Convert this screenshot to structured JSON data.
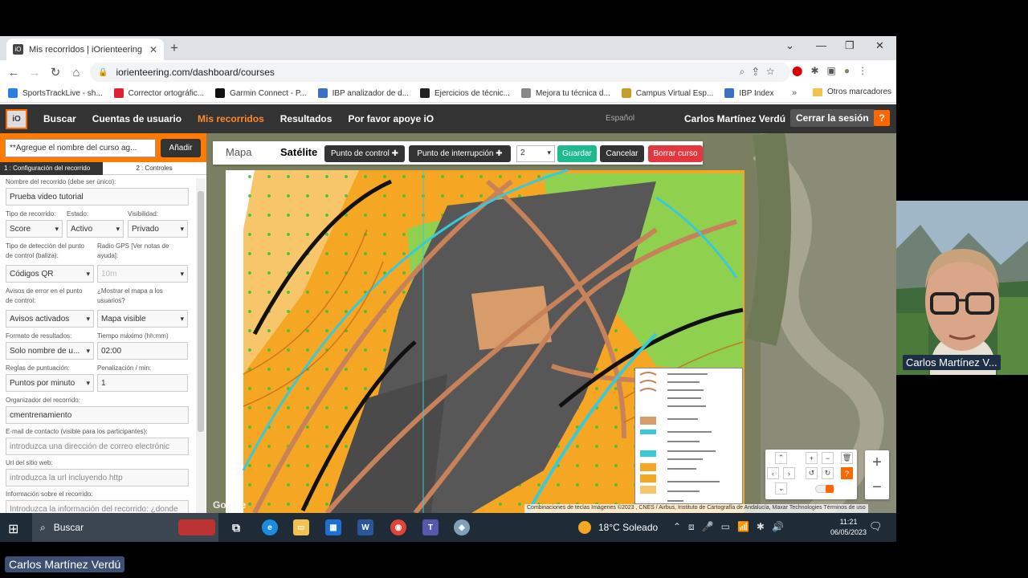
{
  "browser": {
    "tab_title": "Mis recorridos | iOrienteering",
    "tab_favicon": "iO",
    "url": "iorienteering.com/dashboard/courses",
    "bookmarks": [
      {
        "label": "SportsTrackLive - sh...",
        "color": "#2a7de1"
      },
      {
        "label": "Corrector ortográfic...",
        "color": "#d23"
      },
      {
        "label": "Garmin Connect - P...",
        "color": "#111"
      },
      {
        "label": "IBP analizador de d...",
        "color": "#3b6fc4"
      },
      {
        "label": "Ejercicios de técnic...",
        "color": "#222"
      },
      {
        "label": "Mejora tu técnica d...",
        "color": "#888"
      },
      {
        "label": "Campus Virtual Esp...",
        "color": "#c89b2a"
      },
      {
        "label": "IBP Index",
        "color": "#3b6fc4"
      }
    ],
    "bookmarks_more": "»",
    "other_bookmarks": "Otros marcadores"
  },
  "app": {
    "logo": "iO",
    "nav": [
      "Buscar",
      "Cuentas de usuario",
      "Mis recorridos",
      "Resultados",
      "Por favor apoye iO"
    ],
    "active_nav": "Mis recorridos",
    "language": "Español",
    "user_name": "Carlos Martínez Verdú",
    "logout": "Cerrar la sesión",
    "help": "?",
    "accent_color": "#ff7a00"
  },
  "left": {
    "course_select": "**Agregue el nombre del curso ag...",
    "add_button": "Añadir",
    "tab1": "1 : Configuración del recorrido",
    "tab2": "2 : Controles",
    "fields": {
      "name_label": "Nombre del recorrido (debe ser único):",
      "name_value": "Prueba video tutorial",
      "type_label": "Tipo de recorrido:",
      "type_value": "Score",
      "status_label": "Estado:",
      "status_value": "Activo",
      "visibility_label": "Visibilidad:",
      "visibility_value": "Privado",
      "detection_label_1": "Tipo de detección del punto",
      "detection_label_2": "de control (baliza):",
      "detection_value": "Códigos QR",
      "gps_label_1": "Radio GPS [Ver notas de",
      "gps_label_2": "ayuda]:",
      "gps_value": "10m",
      "error_label_1": "Avisos de error en el punto",
      "error_label_2": "de control:",
      "error_value": "Avisos activados",
      "showmap_label_1": "¿Mostrar el mapa a los",
      "showmap_label_2": "usuarios?",
      "showmap_value": "Mapa visible",
      "results_label": "Formato de resultados:",
      "results_value": "Solo nombre de u...",
      "maxtime_label": "Tiempo máximo (hh:mm)",
      "maxtime_value": "02:00",
      "scoring_label": "Reglas de puntuación:",
      "scoring_value": "Puntos por minuto",
      "penalty_label": "Penalización / min:",
      "penalty_value": "1",
      "organizer_label": "Organizador del recorrido:",
      "organizer_value": "cmentrenamiento",
      "email_label": "E-mail de contacto (visible para los participantes):",
      "email_placeholder": "introduzca una dirección de correo electrónic",
      "url_label": "Url del sitio web:",
      "url_placeholder": "introduzca la url incluyendo http",
      "info_label": "Información sobre el recorrido:",
      "info_placeholder": "Introduzca la información del recorrido: ¿donde"
    }
  },
  "map": {
    "tab_map": "Mapa",
    "tab_satellite": "Satélite",
    "control_point": "Punto de control ✚",
    "interruption_point": "Punto de interrupción ✚",
    "number_select": "2",
    "save": "Guardar",
    "cancel": "Cancelar",
    "delete_course": "Borrar curso",
    "google": "Google",
    "attribution": "Combinaciones de teclas   Imágenes ©2023 , CNES / Airbus, Instituto de Cartografía de Andalucía, Maxar Technologies   Términos de uso",
    "zoom_in": "+",
    "zoom_out": "−"
  },
  "taskbar": {
    "search": "Buscar",
    "weather": "18°C  Soleado",
    "time": "11:21",
    "date": "06/05/2023"
  },
  "webcam": {
    "name": "Carlos Martínez V..."
  },
  "footer_name": "Carlos Martínez Verdú"
}
